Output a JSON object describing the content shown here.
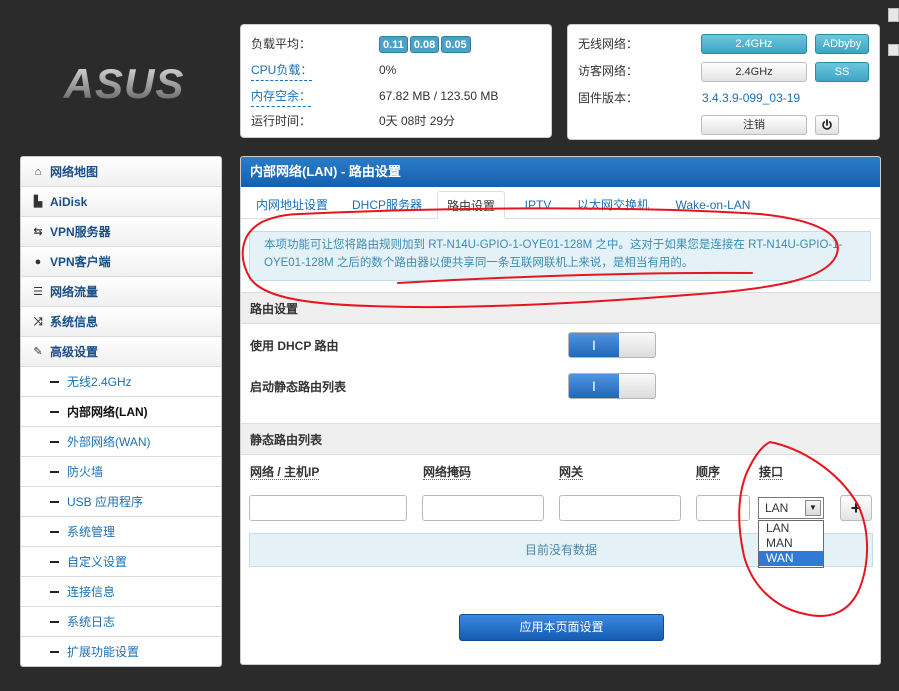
{
  "brand": {
    "logo_text": "ASUS"
  },
  "status_left": {
    "load_label": "负载平均：",
    "load_values": [
      "0.11",
      "0.08",
      "0.05"
    ],
    "cpu_label": "CPU负载：",
    "cpu_value": "0%",
    "mem_label": "内存空余：",
    "mem_value": "67.82 MB / 123.50 MB",
    "uptime_label": "运行时间：",
    "uptime_value": "0天 08时 29分"
  },
  "status_right": {
    "wireless_label": "无线网络：",
    "wireless_button": "2.4GHz",
    "adbyby_button": "ADbyby",
    "guest_label": "访客网络：",
    "guest_button": "2.4GHz",
    "ss_button": "SS",
    "firmware_label": "固件版本：",
    "firmware_value": "3.4.3.9-099_03-19",
    "logout_button": "注销",
    "power_icon": "power-icon"
  },
  "sidebar": {
    "items": [
      {
        "label": "网络地图",
        "icon": "home-icon",
        "glyph": "⌂"
      },
      {
        "label": "AiDisk",
        "icon": "disk-icon",
        "glyph": "▙"
      },
      {
        "label": "VPN服务器",
        "icon": "retweet-icon",
        "glyph": "⇆"
      },
      {
        "label": "VPN客户端",
        "icon": "globe-icon",
        "glyph": "●"
      },
      {
        "label": "网络流量",
        "icon": "list-icon",
        "glyph": "☰"
      },
      {
        "label": "系统信息",
        "icon": "shuffle-icon",
        "glyph": "⤨"
      },
      {
        "label": "高级设置",
        "icon": "wrench-icon",
        "glyph": "✎"
      }
    ],
    "subitems": [
      {
        "label": "无线2.4GHz"
      },
      {
        "label": "内部网络(LAN)",
        "active": true
      },
      {
        "label": "外部网络(WAN)"
      },
      {
        "label": "防火墙"
      },
      {
        "label": "USB 应用程序"
      },
      {
        "label": "系统管理"
      },
      {
        "label": "自定义设置"
      },
      {
        "label": "连接信息"
      },
      {
        "label": "系统日志"
      },
      {
        "label": "扩展功能设置"
      }
    ]
  },
  "main": {
    "title": "内部网络(LAN) - 路由设置",
    "tabs": [
      {
        "label": "内网地址设置"
      },
      {
        "label": "DHCP服务器"
      },
      {
        "label": "路由设置",
        "active": true
      },
      {
        "label": "IPTV"
      },
      {
        "label": "以太网交换机"
      },
      {
        "label": "Wake-on-LAN"
      }
    ],
    "info": "本项功能可让您将路由规则加到 RT-N14U-GPIO-1-OYE01-128M 之中。这对于如果您是连接在 RT-N14U-GPIO-1-OYE01-128M 之后的数个路由器以便共享同一条互联网联机上来说，是相当有用的。",
    "routing_section": "路由设置",
    "dhcp_route_label": "使用 DHCP 路由",
    "dhcp_route_on": true,
    "static_enable_label": "启动静态路由列表",
    "static_enable_on": true,
    "toggle_on_text": "I",
    "static_list_section": "静态路由列表",
    "columns": [
      "网络 / 主机IP",
      "网络掩码",
      "网关",
      "顺序",
      "接口"
    ],
    "interface_selected": "LAN",
    "interface_options": [
      "LAN",
      "MAN",
      "WAN"
    ],
    "interface_highlighted": "WAN",
    "add_button": "+",
    "no_data": "目前没有数据",
    "apply_button": "应用本页面设置"
  },
  "colors": {
    "header_blue": "#1a6bbd",
    "accent_cyan": "#4aa3c7",
    "annotation_red": "#e8141e"
  }
}
